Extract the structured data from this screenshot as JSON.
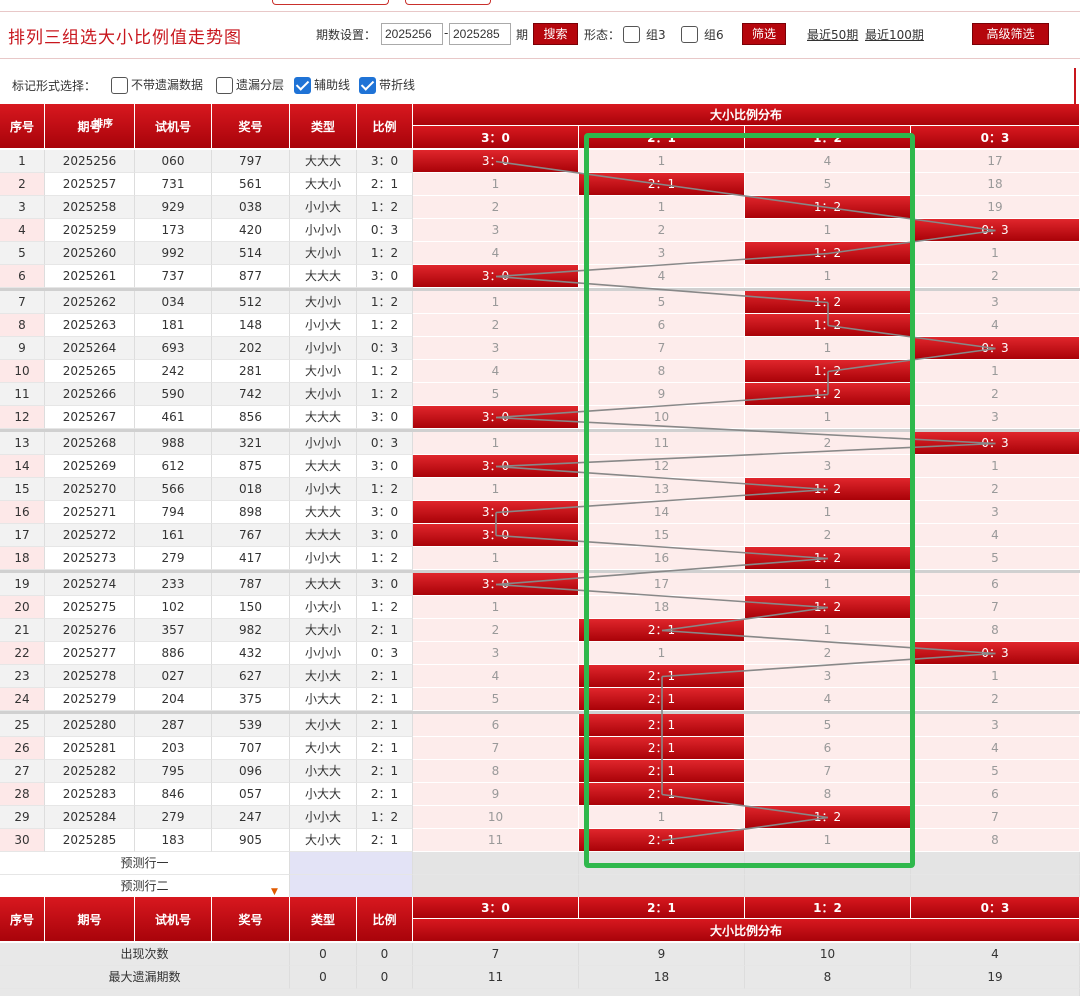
{
  "title": "排列三组选大小比例值走势图",
  "header": {
    "period_label": "期数设置：",
    "from": "2025256",
    "dash": "-",
    "to": "2025285",
    "period_unit": "期",
    "search": "搜索",
    "shape_label": "形态：",
    "group3": "组3",
    "group6": "组6",
    "filter": "筛选",
    "recent50": "最近50期",
    "recent100": "最近100期",
    "advanced": "高级筛选"
  },
  "marker": {
    "label": "标记形式选择：",
    "opt1": "不带遗漏数据",
    "opt2": "遗漏分层",
    "opt3": "辅助线",
    "opt4": "带折线"
  },
  "columns": {
    "seq": "序号",
    "period": "期号",
    "sort": "排序",
    "trial": "试机号",
    "prize": "奖号",
    "type": "类型",
    "ratio": "比例",
    "dist": "大小比例分布",
    "dist_cols": [
      "3：0",
      "2：1",
      "1：2",
      "0：3"
    ]
  },
  "rows": [
    {
      "seq": "1",
      "period": "2025256",
      "trial": "060",
      "prize": "797",
      "type": "大大大",
      "ratio": "3：0",
      "dist": [
        "3：0",
        "1",
        "4",
        "17"
      ],
      "hit": 0
    },
    {
      "seq": "2",
      "period": "2025257",
      "trial": "731",
      "prize": "561",
      "type": "大大小",
      "ratio": "2：1",
      "dist": [
        "1",
        "2：1",
        "5",
        "18"
      ],
      "hit": 1
    },
    {
      "seq": "3",
      "period": "2025258",
      "trial": "929",
      "prize": "038",
      "type": "小小大",
      "ratio": "1：2",
      "dist": [
        "2",
        "1",
        "1：2",
        "19"
      ],
      "hit": 2
    },
    {
      "seq": "4",
      "period": "2025259",
      "trial": "173",
      "prize": "420",
      "type": "小小小",
      "ratio": "0：3",
      "dist": [
        "3",
        "2",
        "1",
        "0：3"
      ],
      "hit": 3
    },
    {
      "seq": "5",
      "period": "2025260",
      "trial": "992",
      "prize": "514",
      "type": "大小小",
      "ratio": "1：2",
      "dist": [
        "4",
        "3",
        "1：2",
        "1"
      ],
      "hit": 2
    },
    {
      "seq": "6",
      "period": "2025261",
      "trial": "737",
      "prize": "877",
      "type": "大大大",
      "ratio": "3：0",
      "dist": [
        "3：0",
        "4",
        "1",
        "2"
      ],
      "hit": 0
    },
    {
      "seq": "7",
      "period": "2025262",
      "trial": "034",
      "prize": "512",
      "type": "大小小",
      "ratio": "1：2",
      "dist": [
        "1",
        "5",
        "1：2",
        "3"
      ],
      "hit": 2
    },
    {
      "seq": "8",
      "period": "2025263",
      "trial": "181",
      "prize": "148",
      "type": "小小大",
      "ratio": "1：2",
      "dist": [
        "2",
        "6",
        "1：2",
        "4"
      ],
      "hit": 2
    },
    {
      "seq": "9",
      "period": "2025264",
      "trial": "693",
      "prize": "202",
      "type": "小小小",
      "ratio": "0：3",
      "dist": [
        "3",
        "7",
        "1",
        "0：3"
      ],
      "hit": 3
    },
    {
      "seq": "10",
      "period": "2025265",
      "trial": "242",
      "prize": "281",
      "type": "大小小",
      "ratio": "1：2",
      "dist": [
        "4",
        "8",
        "1：2",
        "1"
      ],
      "hit": 2
    },
    {
      "seq": "11",
      "period": "2025266",
      "trial": "590",
      "prize": "742",
      "type": "大小小",
      "ratio": "1：2",
      "dist": [
        "5",
        "9",
        "1：2",
        "2"
      ],
      "hit": 2
    },
    {
      "seq": "12",
      "period": "2025267",
      "trial": "461",
      "prize": "856",
      "type": "大大大",
      "ratio": "3：0",
      "dist": [
        "3：0",
        "10",
        "1",
        "3"
      ],
      "hit": 0
    },
    {
      "seq": "13",
      "period": "2025268",
      "trial": "988",
      "prize": "321",
      "type": "小小小",
      "ratio": "0：3",
      "dist": [
        "1",
        "11",
        "2",
        "0：3"
      ],
      "hit": 3
    },
    {
      "seq": "14",
      "period": "2025269",
      "trial": "612",
      "prize": "875",
      "type": "大大大",
      "ratio": "3：0",
      "dist": [
        "3：0",
        "12",
        "3",
        "1"
      ],
      "hit": 0
    },
    {
      "seq": "15",
      "period": "2025270",
      "trial": "566",
      "prize": "018",
      "type": "小小大",
      "ratio": "1：2",
      "dist": [
        "1",
        "13",
        "1：2",
        "2"
      ],
      "hit": 2
    },
    {
      "seq": "16",
      "period": "2025271",
      "trial": "794",
      "prize": "898",
      "type": "大大大",
      "ratio": "3：0",
      "dist": [
        "3：0",
        "14",
        "1",
        "3"
      ],
      "hit": 0
    },
    {
      "seq": "17",
      "period": "2025272",
      "trial": "161",
      "prize": "767",
      "type": "大大大",
      "ratio": "3：0",
      "dist": [
        "3：0",
        "15",
        "2",
        "4"
      ],
      "hit": 0
    },
    {
      "seq": "18",
      "period": "2025273",
      "trial": "279",
      "prize": "417",
      "type": "小小大",
      "ratio": "1：2",
      "dist": [
        "1",
        "16",
        "1：2",
        "5"
      ],
      "hit": 2
    },
    {
      "seq": "19",
      "period": "2025274",
      "trial": "233",
      "prize": "787",
      "type": "大大大",
      "ratio": "3：0",
      "dist": [
        "3：0",
        "17",
        "1",
        "6"
      ],
      "hit": 0
    },
    {
      "seq": "20",
      "period": "2025275",
      "trial": "102",
      "prize": "150",
      "type": "小大小",
      "ratio": "1：2",
      "dist": [
        "1",
        "18",
        "1：2",
        "7"
      ],
      "hit": 2
    },
    {
      "seq": "21",
      "period": "2025276",
      "trial": "357",
      "prize": "982",
      "type": "大大小",
      "ratio": "2：1",
      "dist": [
        "2",
        "2：1",
        "1",
        "8"
      ],
      "hit": 1
    },
    {
      "seq": "22",
      "period": "2025277",
      "trial": "886",
      "prize": "432",
      "type": "小小小",
      "ratio": "0：3",
      "dist": [
        "3",
        "1",
        "2",
        "0：3"
      ],
      "hit": 3
    },
    {
      "seq": "23",
      "period": "2025278",
      "trial": "027",
      "prize": "627",
      "type": "大小大",
      "ratio": "2：1",
      "dist": [
        "4",
        "2：1",
        "3",
        "1"
      ],
      "hit": 1
    },
    {
      "seq": "24",
      "period": "2025279",
      "trial": "204",
      "prize": "375",
      "type": "小大大",
      "ratio": "2：1",
      "dist": [
        "5",
        "2：1",
        "4",
        "2"
      ],
      "hit": 1
    },
    {
      "seq": "25",
      "period": "2025280",
      "trial": "287",
      "prize": "539",
      "type": "大小大",
      "ratio": "2：1",
      "dist": [
        "6",
        "2：1",
        "5",
        "3"
      ],
      "hit": 1
    },
    {
      "seq": "26",
      "period": "2025281",
      "trial": "203",
      "prize": "707",
      "type": "大小大",
      "ratio": "2：1",
      "dist": [
        "7",
        "2：1",
        "6",
        "4"
      ],
      "hit": 1
    },
    {
      "seq": "27",
      "period": "2025282",
      "trial": "795",
      "prize": "096",
      "type": "小大大",
      "ratio": "2：1",
      "dist": [
        "8",
        "2：1",
        "7",
        "5"
      ],
      "hit": 1
    },
    {
      "seq": "28",
      "period": "2025283",
      "trial": "846",
      "prize": "057",
      "type": "小大大",
      "ratio": "2：1",
      "dist": [
        "9",
        "2：1",
        "8",
        "6"
      ],
      "hit": 1
    },
    {
      "seq": "29",
      "period": "2025284",
      "trial": "279",
      "prize": "247",
      "type": "小小大",
      "ratio": "1：2",
      "dist": [
        "10",
        "1",
        "1：2",
        "7"
      ],
      "hit": 2
    },
    {
      "seq": "30",
      "period": "2025285",
      "trial": "183",
      "prize": "905",
      "type": "大小大",
      "ratio": "2：1",
      "dist": [
        "11",
        "2：1",
        "1",
        "8"
      ],
      "hit": 1
    }
  ],
  "predict": [
    "预测行一",
    "预测行二"
  ],
  "stats": [
    {
      "label": "出现次数",
      "type": "0",
      "ratio": "0",
      "vals": [
        "7",
        "9",
        "10",
        "4"
      ]
    },
    {
      "label": "最大遗漏期数",
      "type": "0",
      "ratio": "0",
      "vals": [
        "11",
        "18",
        "8",
        "19"
      ]
    }
  ],
  "colors": {
    "brand_red": "#c8161d",
    "highlight": "#2fb84c"
  }
}
